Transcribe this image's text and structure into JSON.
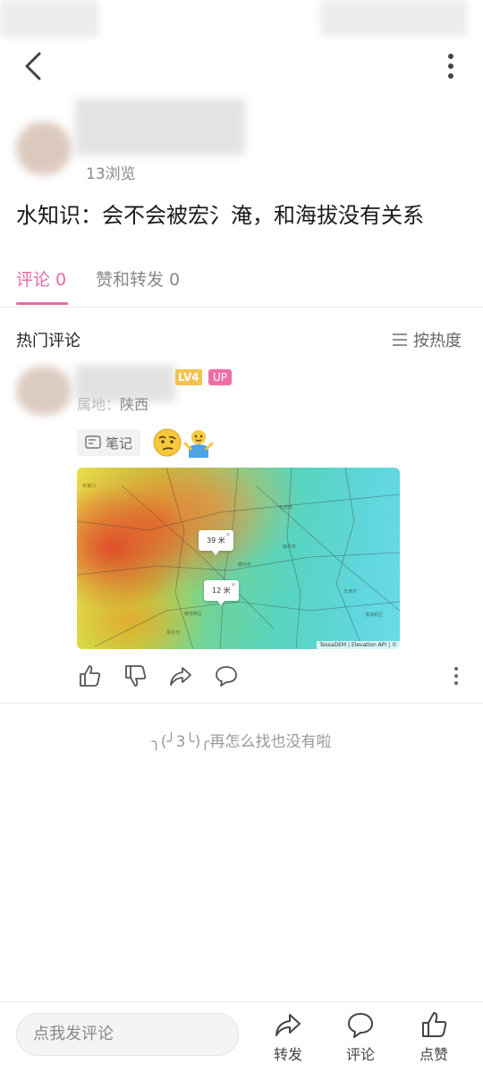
{
  "header": {
    "back_icon": "back-arrow-icon",
    "more_icon": "more-vertical-icon"
  },
  "post": {
    "views": "13浏览",
    "title": "水知识：会不会被宏氵淹，和海拔没有关系"
  },
  "tabs": [
    {
      "label": "评论 0",
      "active": true
    },
    {
      "label": "赞和转发 0",
      "active": false
    }
  ],
  "comments_section": {
    "title": "热门评论",
    "sort_label": "按热度"
  },
  "comment": {
    "level_badge": "LV4",
    "up_badge": "UP",
    "location": "陕西",
    "location_prefix": "属地：",
    "note_label": "笔记",
    "map": {
      "pin1": "39 米",
      "pin2": "12 米",
      "credit": "TessaDEM | Elevation API | ©"
    }
  },
  "end_text": "╮(╯3╰)╭再怎么找也没有啦",
  "bottom_bar": {
    "input_placeholder": "点我发评论",
    "forward": "转发",
    "comment": "评论",
    "like": "点赞"
  },
  "colors": {
    "accent": "#e86aa5",
    "up_badge": "#ef6da6",
    "level_badge": "#f6c24d"
  }
}
